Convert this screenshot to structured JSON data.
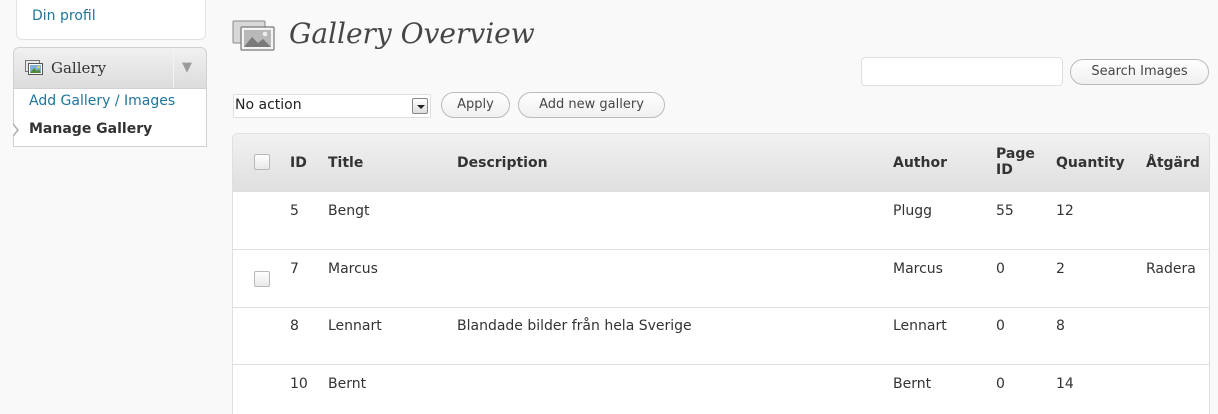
{
  "sidebar": {
    "profile_link": "Din profil",
    "menu_title": "Gallery",
    "menu_icon": "gallery-icon",
    "toggle_icon": "triangle-down-icon",
    "submenu": [
      {
        "label": "Add Gallery / Images"
      },
      {
        "label": "Manage Gallery"
      }
    ]
  },
  "page": {
    "title": "Gallery Overview",
    "title_icon": "gallery-icon"
  },
  "search": {
    "value": "",
    "button_label": "Search Images"
  },
  "bulk": {
    "selected_action": "No action",
    "apply_label": "Apply",
    "add_new_label": "Add new gallery"
  },
  "table": {
    "columns": {
      "id": "ID",
      "title": "Title",
      "description": "Description",
      "author": "Author",
      "page_id_line1": "Page",
      "page_id_line2": "ID",
      "quantity": "Quantity",
      "action": "Åtgärd"
    },
    "rows": [
      {
        "id": "5",
        "title": "Bengt",
        "description": "",
        "author": "Plugg",
        "page_id": "55",
        "quantity": "12",
        "action": "",
        "checkbox": false
      },
      {
        "id": "7",
        "title": "Marcus",
        "description": "",
        "author": "Marcus",
        "page_id": "0",
        "quantity": "2",
        "action": "Radera",
        "checkbox": true
      },
      {
        "id": "8",
        "title": "Lennart",
        "description": "Blandade bilder från hela Sverige",
        "author": "Lennart",
        "page_id": "0",
        "quantity": "8",
        "action": "",
        "checkbox": false
      },
      {
        "id": "10",
        "title": "Bernt",
        "description": "",
        "author": "Bernt",
        "page_id": "0",
        "quantity": "14",
        "action": "",
        "checkbox": false
      }
    ]
  },
  "colors": {
    "link": "#21759b",
    "background": "#f9f9f9",
    "header_gradient_top": "#f1f1f1",
    "header_gradient_bottom": "#dfdfdf"
  }
}
